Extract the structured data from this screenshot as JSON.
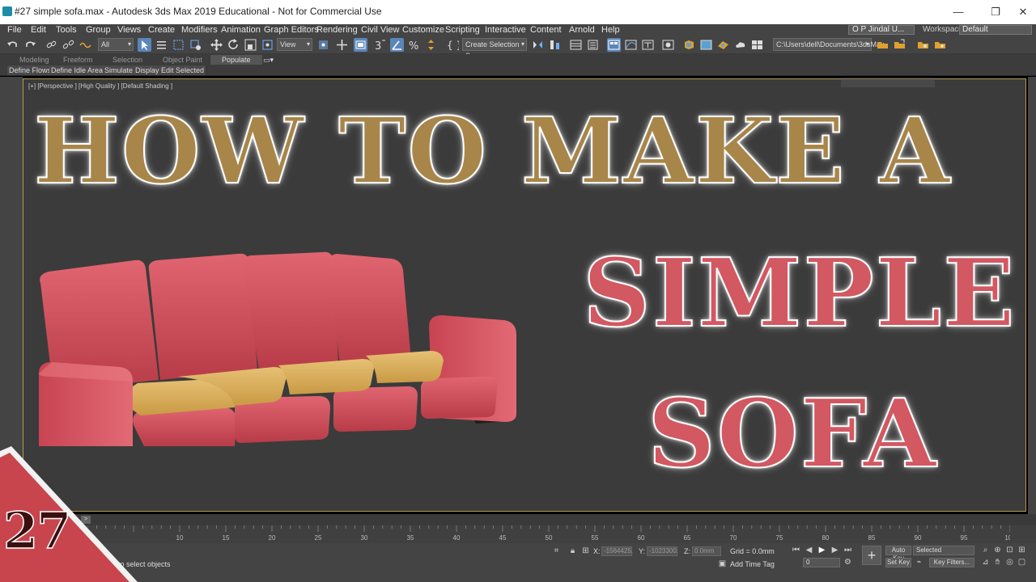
{
  "window": {
    "title": "#27 simple sofa.max - Autodesk 3ds Max 2019 Educational - Not for Commercial Use",
    "minimize": "—",
    "restore": "❐",
    "close": "✕"
  },
  "menu": {
    "items": [
      "File",
      "Edit",
      "Tools",
      "Group",
      "Views",
      "Create",
      "Modifiers",
      "Animation",
      "Graph Editors",
      "Rendering",
      "Civil View",
      "Customize",
      "Scripting",
      "Interactive",
      "Content",
      "Arnold",
      "Help"
    ],
    "user": "O P Jindal U...",
    "workspaces_label": "Workspaces:",
    "workspace": "Default"
  },
  "toolbar": {
    "filter": "All",
    "view": "View",
    "selection_set": "Create Selection Se",
    "path": "C:\\Users\\dell\\Documents\\3dsMax"
  },
  "ribbon": {
    "tabs": [
      "Modeling",
      "Freeform",
      "Selection",
      "Object Paint",
      "Populate"
    ],
    "sub_buttons": [
      "Define Flows",
      "Define Idle Areas",
      "Simulate",
      "Display",
      "Edit Selected"
    ]
  },
  "viewport": {
    "label": "[+] [Perspective ] [High Quality ] [Default Shading ]"
  },
  "headline": {
    "line1": "HOW TO MAKE A",
    "line2": "SIMPLE",
    "line3": "SOFA",
    "gold": "#a8864a",
    "red": "#d25862"
  },
  "episode": "27",
  "timeline": {
    "slider": ">",
    "ticks": [
      "10",
      "15",
      "20",
      "25",
      "30",
      "35",
      "40",
      "45",
      "50",
      "55",
      "60",
      "65",
      "70",
      "75",
      "80",
      "85",
      "90",
      "95",
      "100"
    ]
  },
  "status": {
    "prompt": "to select objects",
    "x_label": "X:",
    "x_value": "-1564425.",
    "y_label": "Y:",
    "y_value": "-1023300.",
    "z_label": "Z:",
    "z_value": "0.0mm",
    "grid": "Grid = 0.0mm",
    "add_time_tag": "Add Time Tag",
    "auto_key": "Auto Key",
    "selected": "Selected",
    "set_key": "Set Key",
    "key_filters": "Key Filters...",
    "frame": "0"
  },
  "colors": {
    "sofa_red": "#d2505a",
    "sofa_cushion": "#d6ad5a",
    "viewport_bg": "#3b3b3b",
    "badge_red": "#c8454d"
  }
}
